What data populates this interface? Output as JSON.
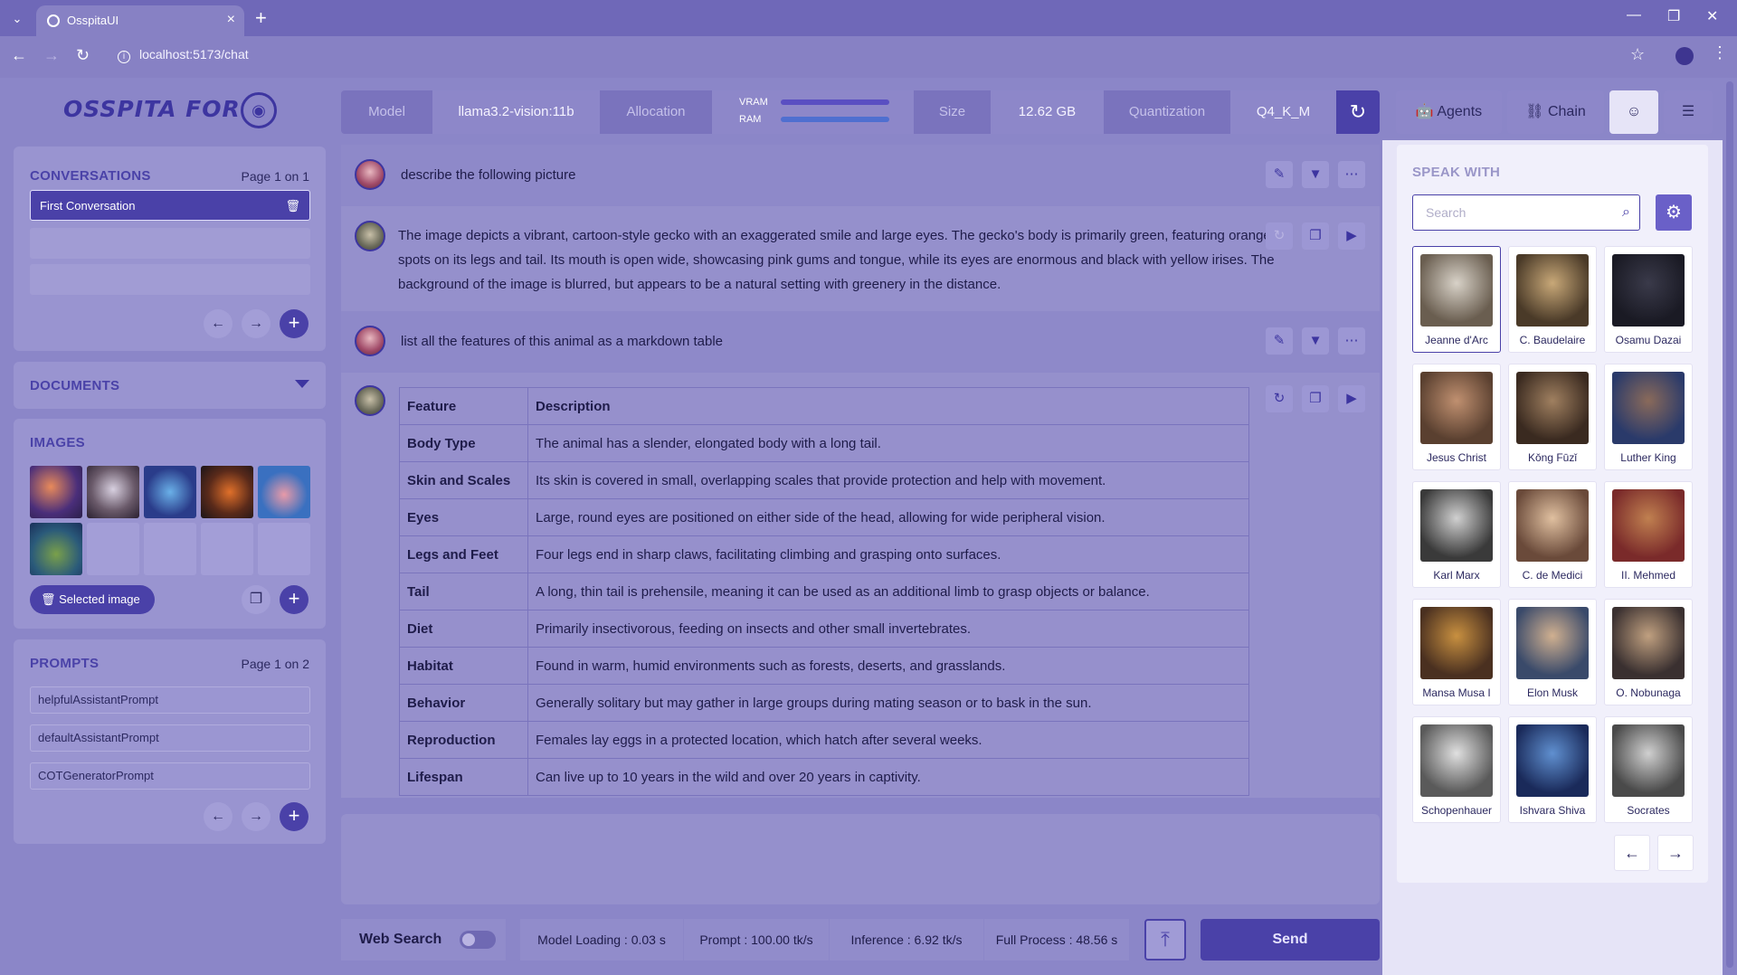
{
  "browser": {
    "tab_title": "OsspitaUI",
    "url": "localhost:5173/chat"
  },
  "app": {
    "logo_text": "OSSPITA FOR"
  },
  "conversations": {
    "title": "CONVERSATIONS",
    "page": "Page 1 on 1",
    "items": [
      "First Conversation"
    ]
  },
  "documents": {
    "title": "DOCUMENTS"
  },
  "images": {
    "title": "IMAGES",
    "selected_button": "Selected image"
  },
  "prompts": {
    "title": "PROMPTS",
    "page": "Page 1 on 2",
    "items": [
      "helpfulAssistantPrompt",
      "defaultAssistantPrompt",
      "COTGeneratorPrompt"
    ]
  },
  "model_bar": {
    "model_label": "Model",
    "model_value": "llama3.2-vision:11b",
    "allocation_label": "Allocation",
    "vram_label": "VRAM",
    "ram_label": "RAM",
    "size_label": "Size",
    "size_value": "12.62 GB",
    "quantization_label": "Quantization",
    "quantization_value": "Q4_K_M"
  },
  "chat": {
    "msg1": "describe the following picture",
    "msg2": "The image depicts a vibrant, cartoon-style gecko with an exaggerated smile and large eyes. The gecko's body is primarily green, featuring orange spots on its legs and tail. Its mouth is open wide, showcasing pink gums and tongue, while its eyes are enormous and black with yellow irises. The background of the image is blurred, but appears to be a natural setting with greenery in the distance.",
    "msg3": "list all the features of this animal as a markdown table",
    "table": {
      "headers": [
        "Feature",
        "Description"
      ],
      "rows": [
        [
          "Body Type",
          "The animal has a slender, elongated body with a long tail."
        ],
        [
          "Skin and Scales",
          "Its skin is covered in small, overlapping scales that provide protection and help with movement."
        ],
        [
          "Eyes",
          "Large, round eyes are positioned on either side of the head, allowing for wide peripheral vision."
        ],
        [
          "Legs and Feet",
          "Four legs end in sharp claws, facilitating climbing and grasping onto surfaces."
        ],
        [
          "Tail",
          "A long, thin tail is prehensile, meaning it can be used as an additional limb to grasp objects or balance."
        ],
        [
          "Diet",
          "Primarily insectivorous, feeding on insects and other small invertebrates."
        ],
        [
          "Habitat",
          "Found in warm, humid environments such as forests, deserts, and grasslands."
        ],
        [
          "Behavior",
          "Generally solitary but may gather in large groups during mating season or to bask in the sun."
        ],
        [
          "Reproduction",
          "Females lay eggs in a protected location, which hatch after several weeks."
        ],
        [
          "Lifespan",
          "Can live up to 10 years in the wild and over 20 years in captivity."
        ]
      ]
    }
  },
  "bottom": {
    "web_search": "Web Search",
    "model_loading": "Model Loading : 0.03 s",
    "prompt_speed": "Prompt : 100.00 tk/s",
    "inference_speed": "Inference : 6.92 tk/s",
    "full_process": "Full Process : 48.56 s",
    "send": "Send"
  },
  "right": {
    "agents_label": "Agents",
    "chain_label": "Chain",
    "speak_with": "SPEAK WITH",
    "search_placeholder": "Search",
    "agents": [
      "Jeanne d'Arc",
      "C. Baudelaire",
      "Osamu Dazai",
      "Jesus Christ",
      "Kǒng Fūzǐ",
      "Luther King",
      "Karl Marx",
      "C. de Medici",
      "II. Mehmed",
      "Mansa Musa I",
      "Elon Musk",
      "O. Nobunaga",
      "Schopenhauer",
      "Ishvara Shiva",
      "Socrates"
    ]
  },
  "colors": {
    "accent": "#4a41a8",
    "background": "#8b86c8",
    "panel": "#e6e4f7"
  }
}
